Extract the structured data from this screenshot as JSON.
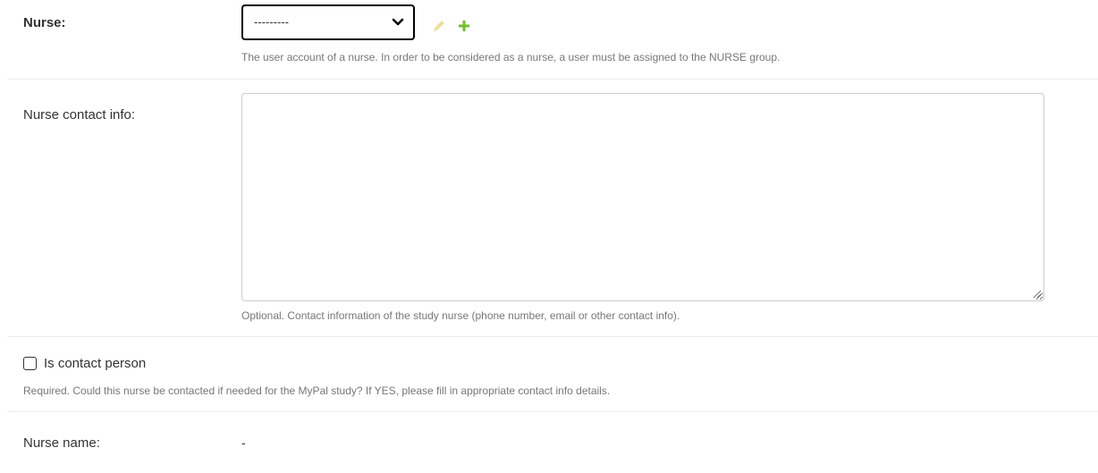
{
  "nurse": {
    "label": "Nurse:",
    "select_value": "---------",
    "help": "The user account of a nurse. In order to be considered as a nurse, a user must be assigned to the NURSE group."
  },
  "contact": {
    "label": "Nurse contact info:",
    "value": "",
    "help": "Optional. Contact information of the study nurse (phone number, email or other contact info)."
  },
  "contact_person": {
    "label": "Is contact person",
    "checked": false,
    "help": "Required. Could this nurse be contacted if needed for the MyPal study? If YES, please fill in appropriate contact info details."
  },
  "nurse_name": {
    "label": "Nurse name:",
    "value": "-"
  },
  "icons": {
    "edit": "pencil-icon",
    "add": "plus-icon",
    "dropdown": "chevron-down-icon",
    "resize": "resize-grip-icon"
  },
  "colors": {
    "edit_icon": "#efe3a0",
    "add_icon": "#70bf2b",
    "select_border": "#000000",
    "help_text": "#777777"
  }
}
